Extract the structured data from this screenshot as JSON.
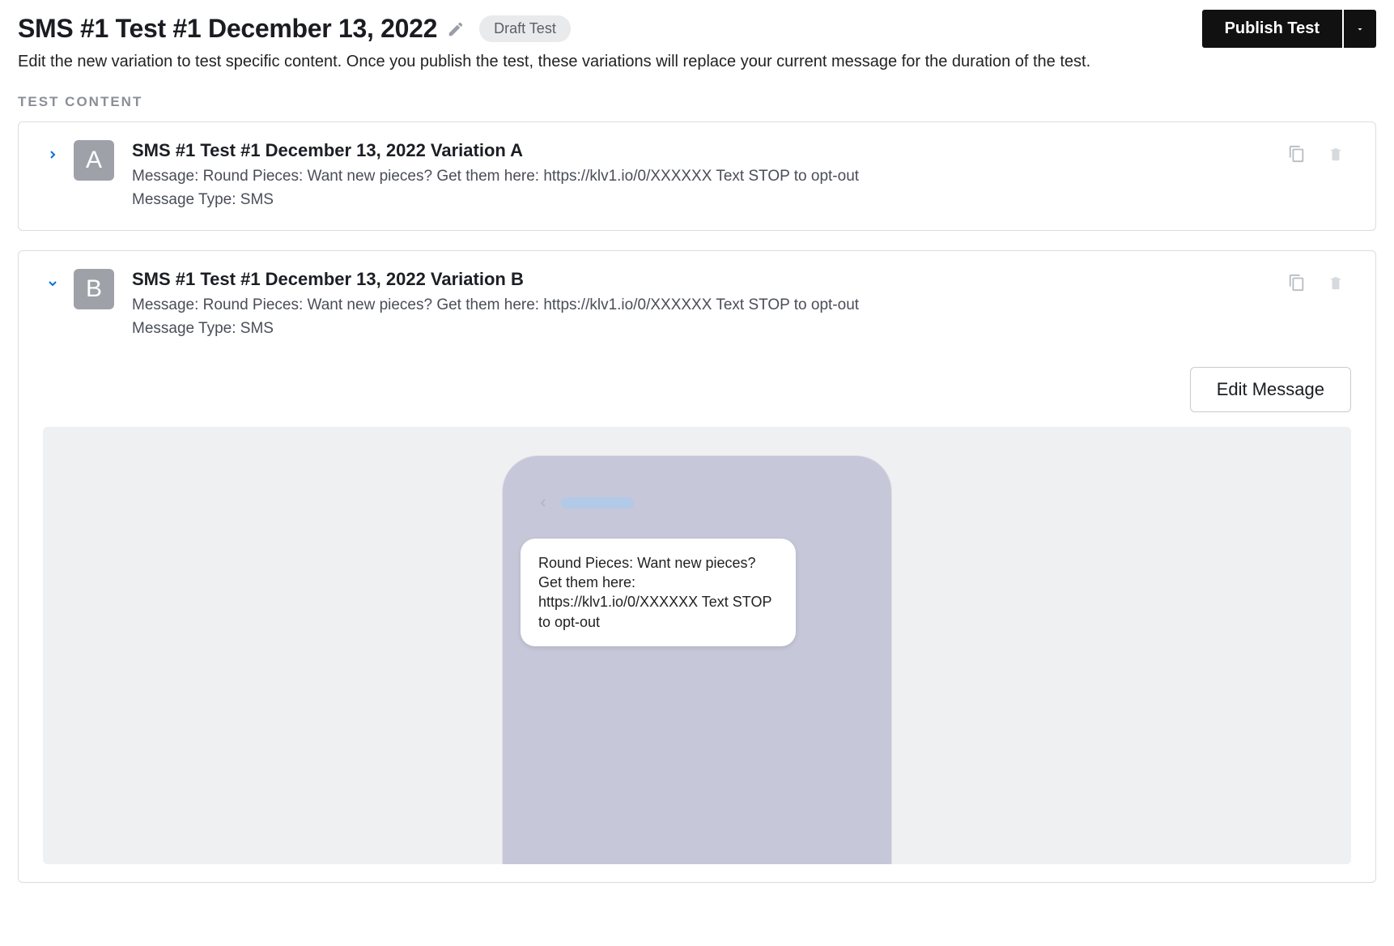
{
  "header": {
    "title": "SMS #1 Test #1 December 13, 2022",
    "status_pill": "Draft Test",
    "publish_label": "Publish Test"
  },
  "description": "Edit the new variation to test specific content. Once you publish the test, these variations will replace your current message for the duration of the test.",
  "section_label": "TEST CONTENT",
  "variations": [
    {
      "letter": "A",
      "title": "SMS #1 Test #1 December 13, 2022 Variation A",
      "message_label": "Message:",
      "message": "Round Pieces: Want new pieces? Get them here: https://klv1.io/0/XXXXXX Text STOP to opt-out",
      "type_label": "Message Type:",
      "type": "SMS",
      "expanded": false
    },
    {
      "letter": "B",
      "title": "SMS #1 Test #1 December 13, 2022 Variation B",
      "message_label": "Message:",
      "message": "Round Pieces: Want new pieces? Get them here: https://klv1.io/0/XXXXXX Text STOP to opt-out",
      "type_label": "Message Type:",
      "type": "SMS",
      "expanded": true,
      "edit_button": "Edit Message",
      "preview_text": "Round Pieces: Want new pieces? Get them here: https://klv1.io/0/XXXXXX Text STOP to opt-out"
    }
  ],
  "icons": {
    "pencil": "pencil-icon",
    "copy": "copy-icon",
    "trash": "trash-icon",
    "chevron_right": "chevron-right-icon",
    "chevron_down": "chevron-down-icon",
    "caret_down": "caret-down-icon"
  }
}
